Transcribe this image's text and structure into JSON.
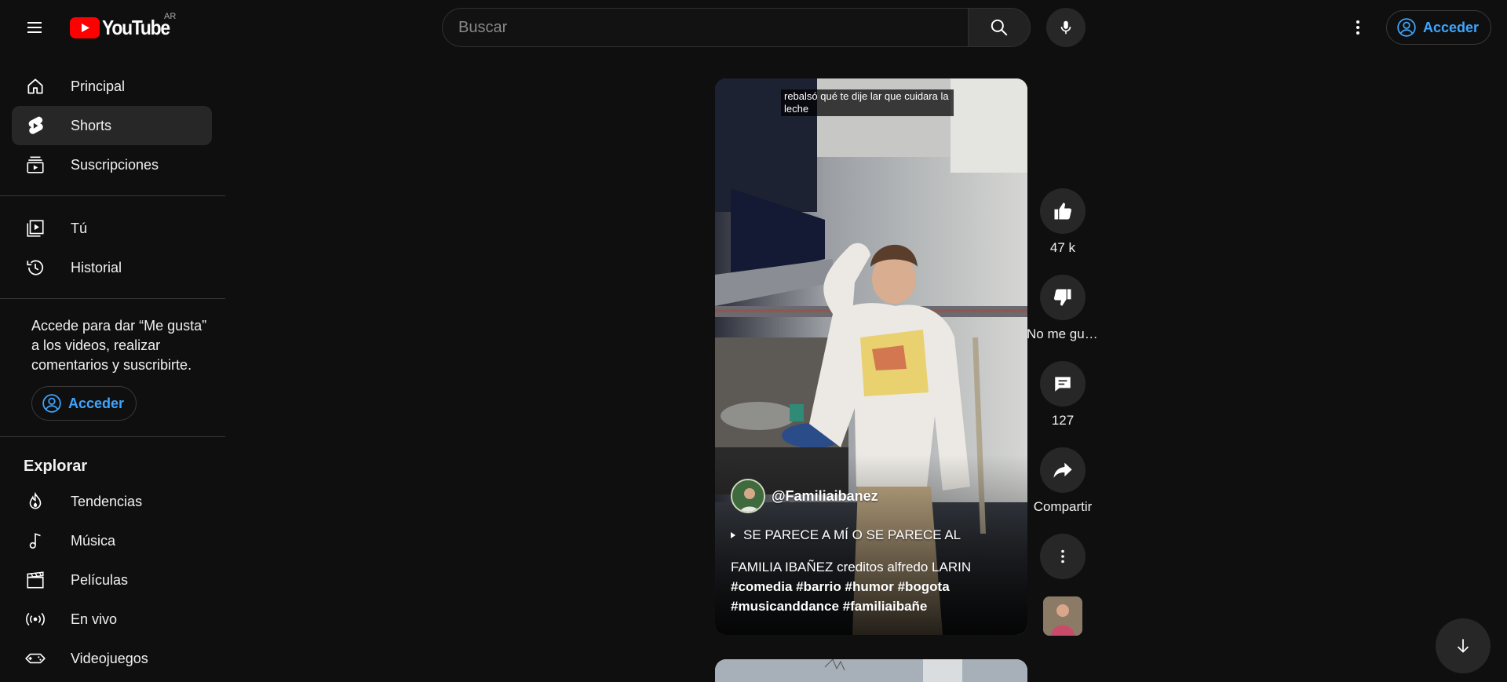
{
  "header": {
    "logo_text": "YouTube",
    "region_code": "AR",
    "search_placeholder": "Buscar",
    "signin_label": "Acceder"
  },
  "sidebar": {
    "main_items": [
      {
        "label": "Principal",
        "icon": "home-icon"
      },
      {
        "label": "Shorts",
        "icon": "shorts-icon",
        "active": true
      },
      {
        "label": "Suscripciones",
        "icon": "subscriptions-icon"
      }
    ],
    "you_items": [
      {
        "label": "Tú",
        "icon": "your-channel-icon"
      },
      {
        "label": "Historial",
        "icon": "history-icon"
      }
    ],
    "signin_note": "Accede para dar “Me gusta” a los videos, realizar comentarios y suscribirte.",
    "signin_label": "Acceder",
    "explore_title": "Explorar",
    "explore_items": [
      {
        "label": "Tendencias",
        "icon": "trending-icon"
      },
      {
        "label": "Música",
        "icon": "music-icon"
      },
      {
        "label": "Películas",
        "icon": "movies-icon"
      },
      {
        "label": "En vivo",
        "icon": "live-icon"
      },
      {
        "label": "Videojuegos",
        "icon": "gaming-icon"
      }
    ]
  },
  "short": {
    "caption": "rebalsó qué te dije lar que cuidara la leche",
    "channel_handle": "@Familiaibanez",
    "sound_title": "SE PARECE A MÍ O SE PARECE AL",
    "description_plain": "FAMILIA IBAÑEZ creditos alfredo LARIN",
    "description_tags": "#comedia #barrio #humor #bogota #musicanddance #familiaibañe"
  },
  "actions": {
    "like_count": "47 k",
    "dislike_label": "No me gusta",
    "comment_count": "127",
    "share_label": "Compartir"
  },
  "colors": {
    "background": "#0f0f0f",
    "accent_blue": "#3ea6ff",
    "brand_red": "#ff0000",
    "button_gray": "#272727"
  }
}
